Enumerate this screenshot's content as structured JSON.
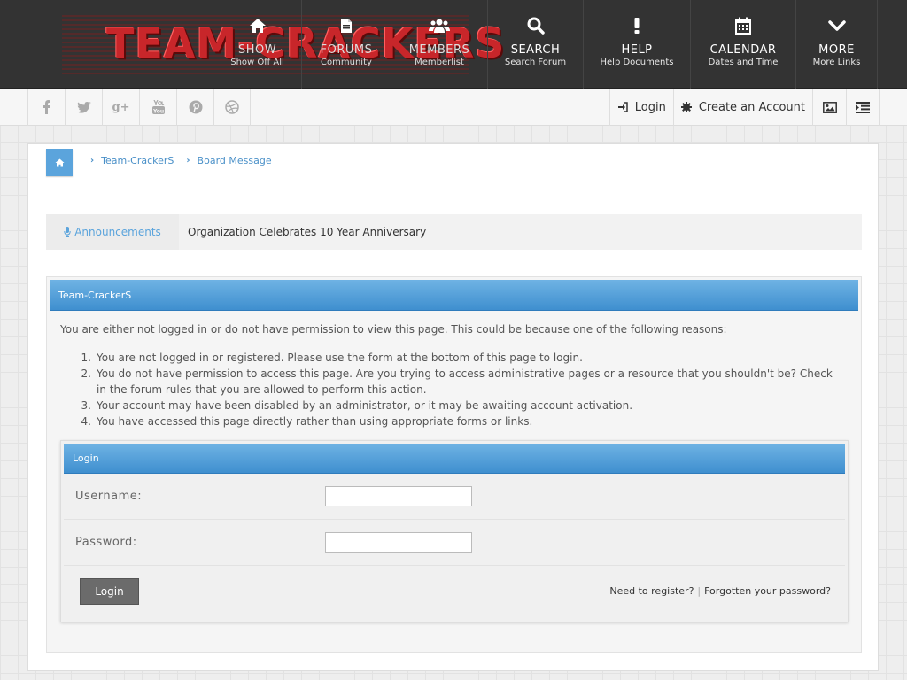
{
  "logo": {
    "text": "TEAM-CRACKERS"
  },
  "nav": [
    {
      "name": "nav-item-show-off",
      "icon": "home-icon",
      "title": "SHOW",
      "sub": "Show Off All"
    },
    {
      "name": "nav-item-forums",
      "icon": "document-icon",
      "title": "FORUMS",
      "sub": "Community"
    },
    {
      "name": "nav-item-members",
      "icon": "users-icon",
      "title": "MEMBERS",
      "sub": "Memberlist"
    },
    {
      "name": "nav-item-search",
      "icon": "search-icon",
      "title": "SEARCH",
      "sub": "Search Forum"
    },
    {
      "name": "nav-item-help",
      "icon": "exclamation-icon",
      "title": "HELP",
      "sub": "Help Documents"
    },
    {
      "name": "nav-item-calendar",
      "icon": "calendar-icon",
      "title": "CALENDAR",
      "sub": "Dates and Time"
    },
    {
      "name": "nav-item-more",
      "icon": "chevron-down-icon",
      "title": "MORE",
      "sub": "More Links"
    }
  ],
  "social": [
    "facebook-icon",
    "twitter-icon",
    "google-plus-icon",
    "youtube-icon",
    "pinterest-icon",
    "dribbble-icon"
  ],
  "account": {
    "login_label": "Login",
    "create_label": "Create an Account"
  },
  "breadcrumb": {
    "items": [
      "Team-CrackerS",
      "Board Message"
    ]
  },
  "announcement": {
    "label": "Announcements",
    "text": "Organization Celebrates 10 Year Anniversary"
  },
  "message": {
    "header": "Team-CrackerS",
    "intro": "You are either not logged in or do not have permission to view this page. This could be because one of the following reasons:",
    "reasons": [
      "You are not logged in or registered. Please use the form at the bottom of this page to login.",
      "You do not have permission to access this page. Are you trying to access administrative pages or a resource that you shouldn't be? Check in the forum rules that you are allowed to perform this action.",
      "Your account may have been disabled by an administrator, or it may be awaiting account activation.",
      "You have accessed this page directly rather than using appropriate forms or links."
    ]
  },
  "login": {
    "header": "Login",
    "username_label": "Username:",
    "username_value": "",
    "password_label": "Password:",
    "password_value": "",
    "button": "Login",
    "register_link": "Need to register?",
    "separator": "|",
    "forgot_link": "Forgotten your password?"
  },
  "colors": {
    "accent": "#5ba4dc",
    "header_bg": "#333333",
    "logo_red": "#c8262a"
  }
}
